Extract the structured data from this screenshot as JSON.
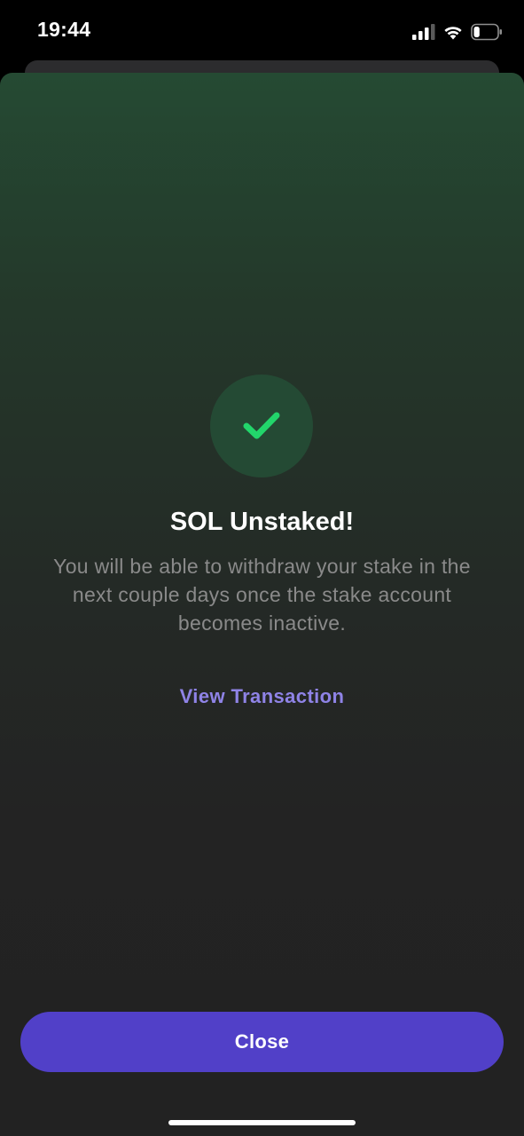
{
  "status_bar": {
    "time": "19:44",
    "icons": [
      "signal-icon",
      "wifi-icon",
      "battery-icon"
    ],
    "battery_level": 0.25
  },
  "modal": {
    "status_icon": "checkmark-icon",
    "title": "SOL Unstaked!",
    "description": "You will be able to withdraw your stake  in the next couple days once the stake account becomes inactive.",
    "link_label": "View Transaction",
    "close_label": "Close"
  },
  "colors": {
    "accent": "#5140c8",
    "link": "#8f83e6",
    "success": "#22d66b",
    "success_bg": "#244a34"
  }
}
